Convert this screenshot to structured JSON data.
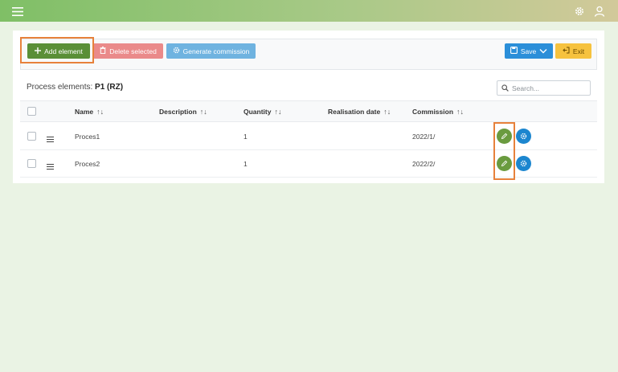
{
  "topbar": {
    "menu_icon": "menu-icon",
    "settings_icon": "gear-icon",
    "user_icon": "user-icon"
  },
  "toolbar": {
    "add_label": "Add element",
    "delete_label": "Delete selected",
    "generate_label": "Generate commission",
    "save_label": "Save",
    "exit_label": "Exit"
  },
  "card": {
    "title_prefix": "Process elements:",
    "title_value": "P1 (RZ)",
    "search_placeholder": "Search..."
  },
  "table": {
    "columns": [
      "Name",
      "Description",
      "Quantity",
      "Realisation date",
      "Commission"
    ],
    "sort_glyph": "↑↓",
    "rows": [
      {
        "name": "Proces1",
        "description": "",
        "quantity": "1",
        "realisation_date": "",
        "commission": "2022/1/"
      },
      {
        "name": "Proces2",
        "description": "",
        "quantity": "1",
        "realisation_date": "",
        "commission": "2022/2/"
      }
    ]
  },
  "colors": {
    "accent_green": "#5a8f37",
    "delete_red": "#ea8a8a",
    "generate_blue": "#6fb3e0",
    "save_blue": "#2b8fd9",
    "exit_yellow": "#f6c23e",
    "highlight_orange": "#e7813b"
  }
}
